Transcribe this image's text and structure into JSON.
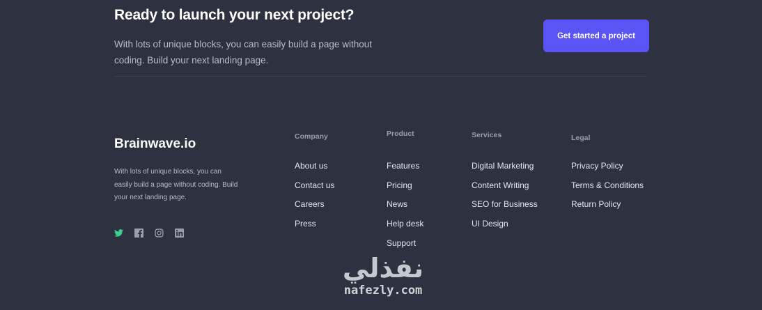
{
  "cta": {
    "title": "Ready to launch your next project?",
    "text": "With lots of unique blocks, you can easily build a page without coding. Build your next landing page.",
    "button_label": "Get started a project",
    "button_color": "#5b54f5"
  },
  "brand": {
    "name": "Brainwave.io",
    "text": "With lots of unique blocks, you can easily build a page without coding. Build your next landing page.",
    "socials": [
      {
        "icon": "twitter-icon",
        "color": "#3ccf8e"
      },
      {
        "icon": "facebook-icon",
        "color": "#9a9eac"
      },
      {
        "icon": "instagram-icon",
        "color": "#9a9eac"
      },
      {
        "icon": "linkedin-icon",
        "color": "#9a9eac"
      }
    ]
  },
  "columns": {
    "company": {
      "heading": "Company",
      "links": [
        "About us",
        "Contact us",
        "Careers",
        "Press"
      ]
    },
    "product": {
      "heading": "Product",
      "links": [
        "Features",
        "Pricing",
        "News",
        "Help desk",
        "Support"
      ]
    },
    "services": {
      "heading": "Services",
      "links": [
        "Digital Marketing",
        "Content Writing",
        "SEO for Business",
        "UI Design"
      ]
    },
    "legal": {
      "heading": "Legal",
      "links": [
        "Privacy Policy",
        "Terms & Conditions",
        "Return Policy"
      ]
    }
  },
  "watermark": {
    "arabic": "نفذلي",
    "latin": "nafezly.com"
  }
}
